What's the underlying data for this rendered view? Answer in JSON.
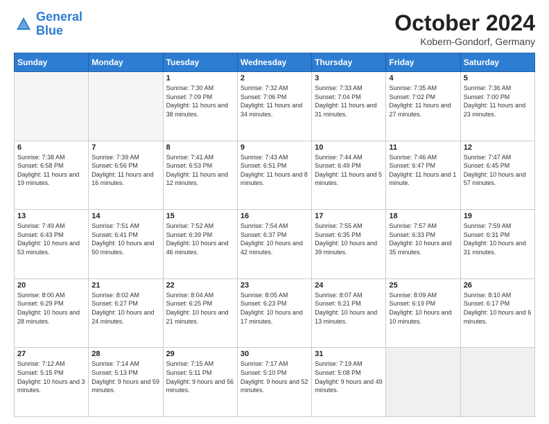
{
  "header": {
    "logo_line1": "General",
    "logo_line2": "Blue",
    "month_title": "October 2024",
    "subtitle": "Kobern-Gondorf, Germany"
  },
  "weekdays": [
    "Sunday",
    "Monday",
    "Tuesday",
    "Wednesday",
    "Thursday",
    "Friday",
    "Saturday"
  ],
  "weeks": [
    [
      {
        "day": "",
        "sunrise": "",
        "sunset": "",
        "daylight": "",
        "empty": true
      },
      {
        "day": "",
        "sunrise": "",
        "sunset": "",
        "daylight": "",
        "empty": true
      },
      {
        "day": "1",
        "sunrise": "Sunrise: 7:30 AM",
        "sunset": "Sunset: 7:09 PM",
        "daylight": "Daylight: 11 hours and 38 minutes."
      },
      {
        "day": "2",
        "sunrise": "Sunrise: 7:32 AM",
        "sunset": "Sunset: 7:06 PM",
        "daylight": "Daylight: 11 hours and 34 minutes."
      },
      {
        "day": "3",
        "sunrise": "Sunrise: 7:33 AM",
        "sunset": "Sunset: 7:04 PM",
        "daylight": "Daylight: 11 hours and 31 minutes."
      },
      {
        "day": "4",
        "sunrise": "Sunrise: 7:35 AM",
        "sunset": "Sunset: 7:02 PM",
        "daylight": "Daylight: 11 hours and 27 minutes."
      },
      {
        "day": "5",
        "sunrise": "Sunrise: 7:36 AM",
        "sunset": "Sunset: 7:00 PM",
        "daylight": "Daylight: 11 hours and 23 minutes."
      }
    ],
    [
      {
        "day": "6",
        "sunrise": "Sunrise: 7:38 AM",
        "sunset": "Sunset: 6:58 PM",
        "daylight": "Daylight: 11 hours and 19 minutes."
      },
      {
        "day": "7",
        "sunrise": "Sunrise: 7:39 AM",
        "sunset": "Sunset: 6:56 PM",
        "daylight": "Daylight: 11 hours and 16 minutes."
      },
      {
        "day": "8",
        "sunrise": "Sunrise: 7:41 AM",
        "sunset": "Sunset: 6:53 PM",
        "daylight": "Daylight: 11 hours and 12 minutes."
      },
      {
        "day": "9",
        "sunrise": "Sunrise: 7:43 AM",
        "sunset": "Sunset: 6:51 PM",
        "daylight": "Daylight: 11 hours and 8 minutes."
      },
      {
        "day": "10",
        "sunrise": "Sunrise: 7:44 AM",
        "sunset": "Sunset: 6:49 PM",
        "daylight": "Daylight: 11 hours and 5 minutes."
      },
      {
        "day": "11",
        "sunrise": "Sunrise: 7:46 AM",
        "sunset": "Sunset: 6:47 PM",
        "daylight": "Daylight: 11 hours and 1 minute."
      },
      {
        "day": "12",
        "sunrise": "Sunrise: 7:47 AM",
        "sunset": "Sunset: 6:45 PM",
        "daylight": "Daylight: 10 hours and 57 minutes."
      }
    ],
    [
      {
        "day": "13",
        "sunrise": "Sunrise: 7:49 AM",
        "sunset": "Sunset: 6:43 PM",
        "daylight": "Daylight: 10 hours and 53 minutes."
      },
      {
        "day": "14",
        "sunrise": "Sunrise: 7:51 AM",
        "sunset": "Sunset: 6:41 PM",
        "daylight": "Daylight: 10 hours and 50 minutes."
      },
      {
        "day": "15",
        "sunrise": "Sunrise: 7:52 AM",
        "sunset": "Sunset: 6:39 PM",
        "daylight": "Daylight: 10 hours and 46 minutes."
      },
      {
        "day": "16",
        "sunrise": "Sunrise: 7:54 AM",
        "sunset": "Sunset: 6:37 PM",
        "daylight": "Daylight: 10 hours and 42 minutes."
      },
      {
        "day": "17",
        "sunrise": "Sunrise: 7:55 AM",
        "sunset": "Sunset: 6:35 PM",
        "daylight": "Daylight: 10 hours and 39 minutes."
      },
      {
        "day": "18",
        "sunrise": "Sunrise: 7:57 AM",
        "sunset": "Sunset: 6:33 PM",
        "daylight": "Daylight: 10 hours and 35 minutes."
      },
      {
        "day": "19",
        "sunrise": "Sunrise: 7:59 AM",
        "sunset": "Sunset: 6:31 PM",
        "daylight": "Daylight: 10 hours and 31 minutes."
      }
    ],
    [
      {
        "day": "20",
        "sunrise": "Sunrise: 8:00 AM",
        "sunset": "Sunset: 6:29 PM",
        "daylight": "Daylight: 10 hours and 28 minutes."
      },
      {
        "day": "21",
        "sunrise": "Sunrise: 8:02 AM",
        "sunset": "Sunset: 6:27 PM",
        "daylight": "Daylight: 10 hours and 24 minutes."
      },
      {
        "day": "22",
        "sunrise": "Sunrise: 8:04 AM",
        "sunset": "Sunset: 6:25 PM",
        "daylight": "Daylight: 10 hours and 21 minutes."
      },
      {
        "day": "23",
        "sunrise": "Sunrise: 8:05 AM",
        "sunset": "Sunset: 6:23 PM",
        "daylight": "Daylight: 10 hours and 17 minutes."
      },
      {
        "day": "24",
        "sunrise": "Sunrise: 8:07 AM",
        "sunset": "Sunset: 6:21 PM",
        "daylight": "Daylight: 10 hours and 13 minutes."
      },
      {
        "day": "25",
        "sunrise": "Sunrise: 8:09 AM",
        "sunset": "Sunset: 6:19 PM",
        "daylight": "Daylight: 10 hours and 10 minutes."
      },
      {
        "day": "26",
        "sunrise": "Sunrise: 8:10 AM",
        "sunset": "Sunset: 6:17 PM",
        "daylight": "Daylight: 10 hours and 6 minutes."
      }
    ],
    [
      {
        "day": "27",
        "sunrise": "Sunrise: 7:12 AM",
        "sunset": "Sunset: 5:15 PM",
        "daylight": "Daylight: 10 hours and 3 minutes."
      },
      {
        "day": "28",
        "sunrise": "Sunrise: 7:14 AM",
        "sunset": "Sunset: 5:13 PM",
        "daylight": "Daylight: 9 hours and 59 minutes."
      },
      {
        "day": "29",
        "sunrise": "Sunrise: 7:15 AM",
        "sunset": "Sunset: 5:11 PM",
        "daylight": "Daylight: 9 hours and 56 minutes."
      },
      {
        "day": "30",
        "sunrise": "Sunrise: 7:17 AM",
        "sunset": "Sunset: 5:10 PM",
        "daylight": "Daylight: 9 hours and 52 minutes."
      },
      {
        "day": "31",
        "sunrise": "Sunrise: 7:19 AM",
        "sunset": "Sunset: 5:08 PM",
        "daylight": "Daylight: 9 hours and 49 minutes."
      },
      {
        "day": "",
        "sunrise": "",
        "sunset": "",
        "daylight": "",
        "empty": true
      },
      {
        "day": "",
        "sunrise": "",
        "sunset": "",
        "daylight": "",
        "empty": true
      }
    ]
  ]
}
